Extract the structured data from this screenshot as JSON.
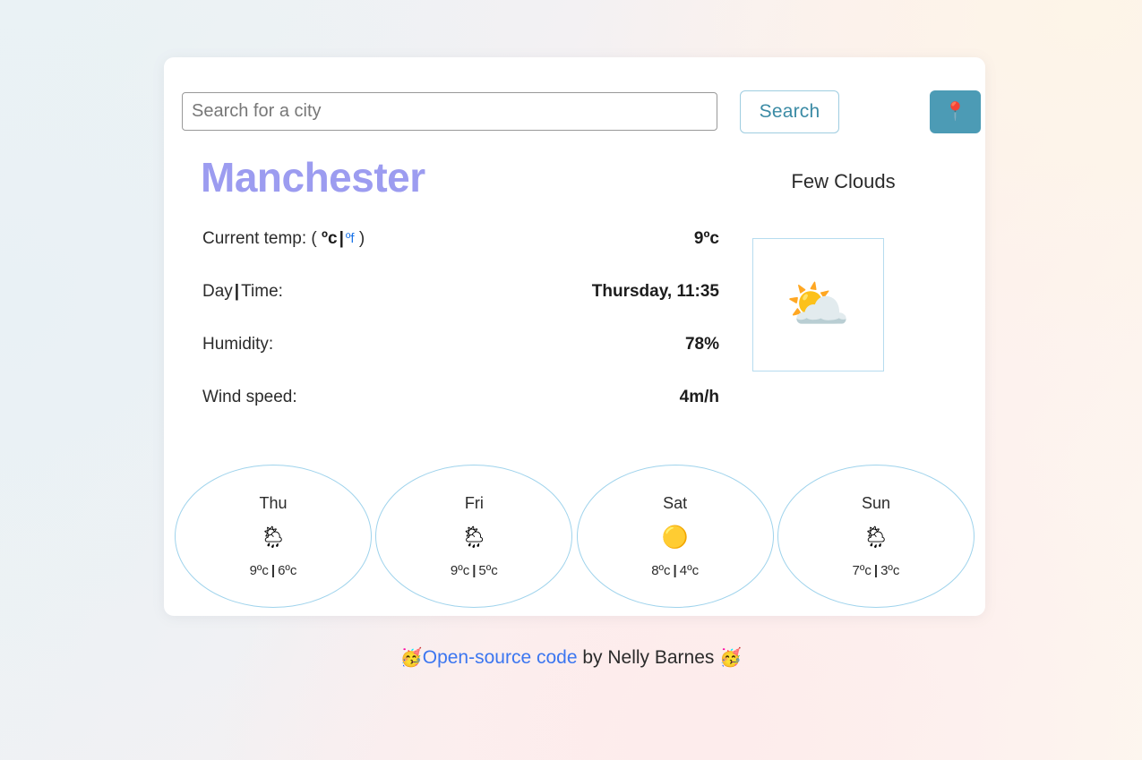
{
  "search": {
    "placeholder": "Search for a city",
    "value": "",
    "button_label": "Search",
    "location_icon": "round-pushpin-icon",
    "location_glyph": "📍",
    "button_border_color": "#9fcde0",
    "button_text_color": "#3b8ba5",
    "location_button_color": "#4c9bb5"
  },
  "city": {
    "name": "Manchester",
    "color": "#9c9cf0"
  },
  "condition": {
    "text": "Few Clouds",
    "icon_name": "sun-behind-cloud-icon",
    "icon_glyph": "⛅",
    "icon_box_border": "#b6dcef"
  },
  "details": [
    {
      "label_prefix": "Current temp: (",
      "unit_celsius": "ºc",
      "unit_separator": "|",
      "unit_fahrenheit": "ºf",
      "label_suffix": ")",
      "value": "9ºc",
      "type": "temp-units"
    },
    {
      "label_a": "Day",
      "label_separator": "|",
      "label_b": "Time:",
      "value": "Thursday, 11:35",
      "type": "day-time"
    },
    {
      "label": "Humidity:",
      "value": "78%",
      "type": "plain"
    },
    {
      "label": "Wind speed:",
      "value": "4m/h",
      "type": "plain"
    }
  ],
  "forecast": {
    "border_color": "#9fd3ec",
    "days": [
      {
        "day": "Thu",
        "icon_name": "sun-behind-rain-cloud-icon",
        "icon_glyph": "🌦",
        "high": "9ºc",
        "separator": "|",
        "low": "6ºc"
      },
      {
        "day": "Fri",
        "icon_name": "sun-behind-rain-cloud-icon",
        "icon_glyph": "🌦",
        "high": "9ºc",
        "separator": "|",
        "low": "5ºc"
      },
      {
        "day": "Sat",
        "icon_name": "sun-icon",
        "icon_glyph": "🟡",
        "high": "8ºc",
        "separator": "|",
        "low": "4ºc"
      },
      {
        "day": "Sun",
        "icon_name": "sun-behind-rain-cloud-icon",
        "icon_glyph": "🌦",
        "high": "7ºc",
        "separator": "|",
        "low": "3ºc"
      }
    ]
  },
  "footer": {
    "emoji_left": "🥳",
    "link_text": "Open-source code",
    "author_text": " by Nelly Barnes ",
    "emoji_right": "🥳",
    "link_color": "#3b76f0"
  }
}
